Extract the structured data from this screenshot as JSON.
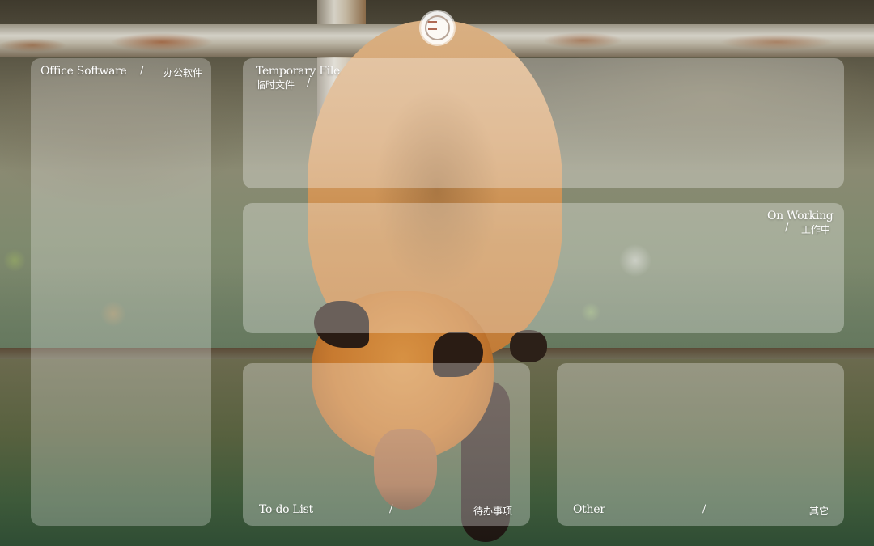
{
  "desktop": {
    "labels": {
      "office": {
        "en": "Office Software",
        "separator": "/",
        "cn": "办公软件"
      },
      "temporary": {
        "en": "Temporary File",
        "cn": "临时文件",
        "separator": "/"
      },
      "working": {
        "en": "On Working",
        "separator": "/",
        "cn": "工作中"
      },
      "todo": {
        "en": "To-do List",
        "separator": "/",
        "cn": "待办事项"
      },
      "other": {
        "en": "Other",
        "separator": "/",
        "cn": "其它"
      }
    }
  }
}
